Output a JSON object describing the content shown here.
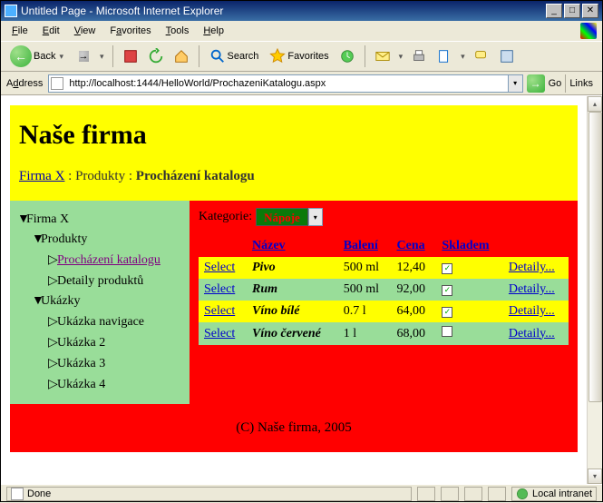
{
  "window": {
    "title": "Untitled Page - Microsoft Internet Explorer"
  },
  "menubar": {
    "file": "File",
    "edit": "Edit",
    "view": "View",
    "favorites": "Favorites",
    "tools": "Tools",
    "help": "Help"
  },
  "toolbar": {
    "back": "Back",
    "search": "Search",
    "favorites": "Favorites"
  },
  "addressbar": {
    "label": "Address",
    "url": "http://localhost:1444/HelloWorld/ProchazeniKatalogu.aspx",
    "go": "Go",
    "links": "Links"
  },
  "header": {
    "title": "Naše firma",
    "crumb_link": "Firma X",
    "crumb_mid": "Produkty",
    "crumb_last": "Procházení katalogu"
  },
  "sidebar": {
    "root": "Firma X",
    "produkty": "Produkty",
    "prochazeni": "Procházení katalogu",
    "detaily": "Detaily produktů",
    "ukazky": "Ukázky",
    "u_nav": "Ukázka navigace",
    "u2": "Ukázka 2",
    "u3": "Ukázka 3",
    "u4": "Ukázka 4"
  },
  "catalog": {
    "label": "Kategorie:",
    "selected": "Nápoje",
    "cols": {
      "sel": "",
      "name": "Název",
      "pack": "Balení",
      "price": "Cena",
      "stock": "Skladem",
      "det": ""
    },
    "select_label": "Select",
    "detail_label": "Detaily...",
    "rows": [
      {
        "name": "Pivo",
        "pack": "500 ml",
        "price": "12,40",
        "stock": true
      },
      {
        "name": "Rum",
        "pack": "500 ml",
        "price": "92,00",
        "stock": true
      },
      {
        "name": "Víno bílé",
        "pack": "0.7 l",
        "price": "64,00",
        "stock": true
      },
      {
        "name": "Víno červené",
        "pack": "1 l",
        "price": "68,00",
        "stock": false
      }
    ]
  },
  "footer": {
    "text": "(C) Naše firma, 2005"
  },
  "statusbar": {
    "done": "Done",
    "zone": "Local intranet"
  }
}
